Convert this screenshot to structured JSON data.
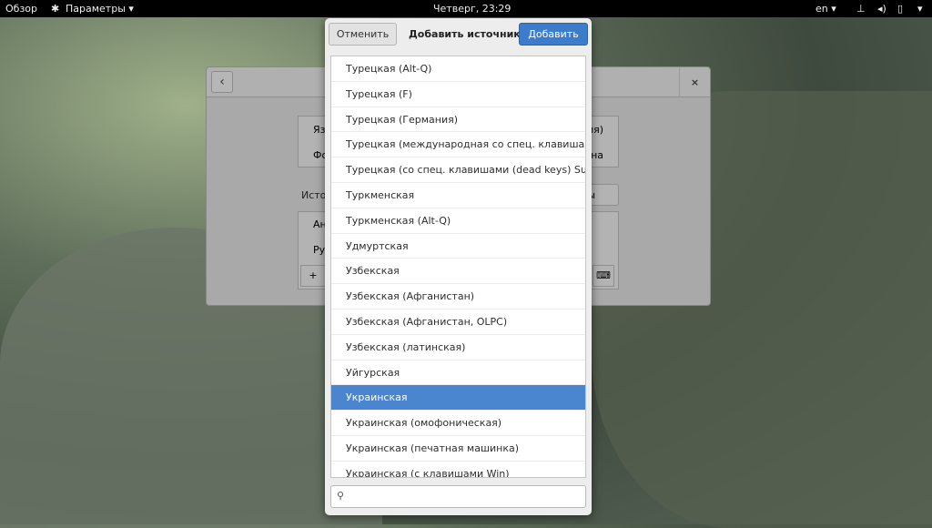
{
  "topbar": {
    "overview": "Обзор",
    "app_menu": "Параметры ▾",
    "clock": "Четверг, 23:29",
    "lang": "en ▾",
    "icons": [
      "network-icon",
      "volume-icon",
      "battery-icon"
    ],
    "menu_arrow": "▾"
  },
  "settings_window": {
    "back": "‹",
    "close": "×",
    "row1_left": "Яз",
    "row1_right": "ия)",
    "row2_left": "Фо",
    "row2_right": "на",
    "sources_label": "Исто",
    "options_btn": "тры",
    "src1": "Ан",
    "src2": "Ру",
    "add": "+"
  },
  "dialog": {
    "cancel": "Отменить",
    "title": "Добавить источник...",
    "add": "Добавить",
    "search_placeholder": "",
    "items": [
      "Турецкая (Alt-Q)",
      "Турецкая (F)",
      "Турецкая (Германия)",
      "Турецкая (международная со спец. клавишами)",
      "Турецкая (со спец. клавишами (dead keys) Sun)",
      "Туркменская",
      "Туркменская (Alt-Q)",
      "Удмуртская",
      "Узбекская",
      "Узбекская (Афганистан)",
      "Узбекская (Афганистан, OLPC)",
      "Узбекская (латинская)",
      "Уйгурская",
      "Украинская",
      "Украинская (омофоническая)",
      "Украинская (печатная машинка)",
      "Украинская (с клавишами Win)"
    ],
    "selected_index": 13
  },
  "colors": {
    "accent": "#3d7ccb",
    "selected_row": "#4a86cf"
  }
}
